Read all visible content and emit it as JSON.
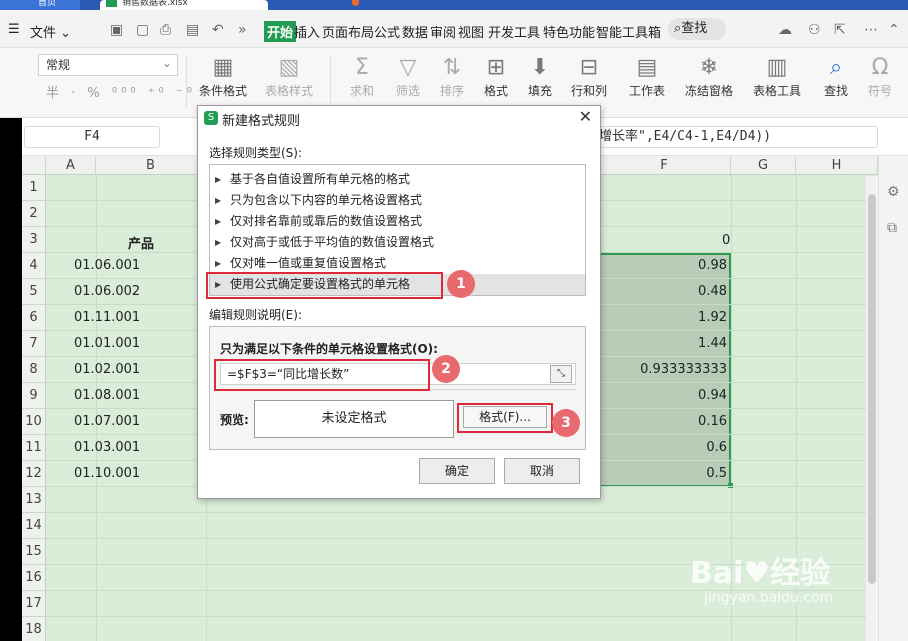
{
  "app": {
    "home_tab": "首页",
    "file_tab": "销售数据表.xlsx"
  },
  "menu": {
    "file_label": "文件",
    "tabs": [
      "开始",
      "插入",
      "页面布局",
      "公式",
      "数据",
      "审阅",
      "视图",
      "开发工具",
      "特色功能",
      "智能工具箱"
    ],
    "search_label": "查找"
  },
  "toolbar": {
    "number_format": "常规",
    "number_buttons": "半 · % ⁰⁰⁰ ⁺⁰ ⁻⁰",
    "tools": [
      "条件格式",
      "表格样式",
      "求和",
      "筛选",
      "排序",
      "格式",
      "填充",
      "行和列",
      "工作表",
      "冻结窗格",
      "表格工具",
      "查找",
      "符号"
    ]
  },
  "formula_bar": {
    "name_box": "F4",
    "formula_text": "增长率\",E4/C4-1,E4/D4))"
  },
  "sheet": {
    "columns": [
      "A",
      "B",
      "F",
      "G",
      "H"
    ],
    "rows": [
      "1",
      "2",
      "3",
      "4",
      "5",
      "6",
      "7",
      "8",
      "9",
      "10",
      "11",
      "12",
      "13",
      "14",
      "15",
      "16",
      "17",
      "18"
    ],
    "b_header": "产品",
    "b_values": [
      "01.06.001",
      "01.06.002",
      "01.11.001",
      "01.01.001",
      "01.02.001",
      "01.08.001",
      "01.07.001",
      "01.03.001",
      "01.10.001"
    ],
    "f3_value": "0",
    "f_values": [
      "0.98",
      "0.48",
      "1.92",
      "1.44",
      "0.933333333",
      "0.94",
      "0.16",
      "0.6",
      "0.5"
    ]
  },
  "dialog": {
    "title": "新建格式规则",
    "close": "✕",
    "select_type_label": "选择规则类型(S):",
    "rules": [
      "基于各自值设置所有单元格的格式",
      "只为包含以下内容的单元格设置格式",
      "仅对排名靠前或靠后的数值设置格式",
      "仅对高于或低于平均值的数值设置格式",
      "仅对唯一值或重复值设置格式",
      "使用公式确定要设置格式的单元格"
    ],
    "edit_desc_label": "编辑规则说明(E):",
    "condition_label": "只为满足以下条件的单元格设置格式(O):",
    "formula_value": "=$F$3=“同比增长数”",
    "preview_label": "预览:",
    "preview_text": "未设定格式",
    "format_button": "格式(F)...",
    "ok_button": "确定",
    "cancel_button": "取消"
  },
  "annotations": [
    "1",
    "2",
    "3"
  ],
  "watermark": {
    "brand": "Bai♥经验",
    "url": "jingyan.baidu.com"
  },
  "colors": {
    "accent_green": "#1f9e53",
    "sheet_green": "#d9edd9",
    "annotation_red": "#dd2a36"
  }
}
